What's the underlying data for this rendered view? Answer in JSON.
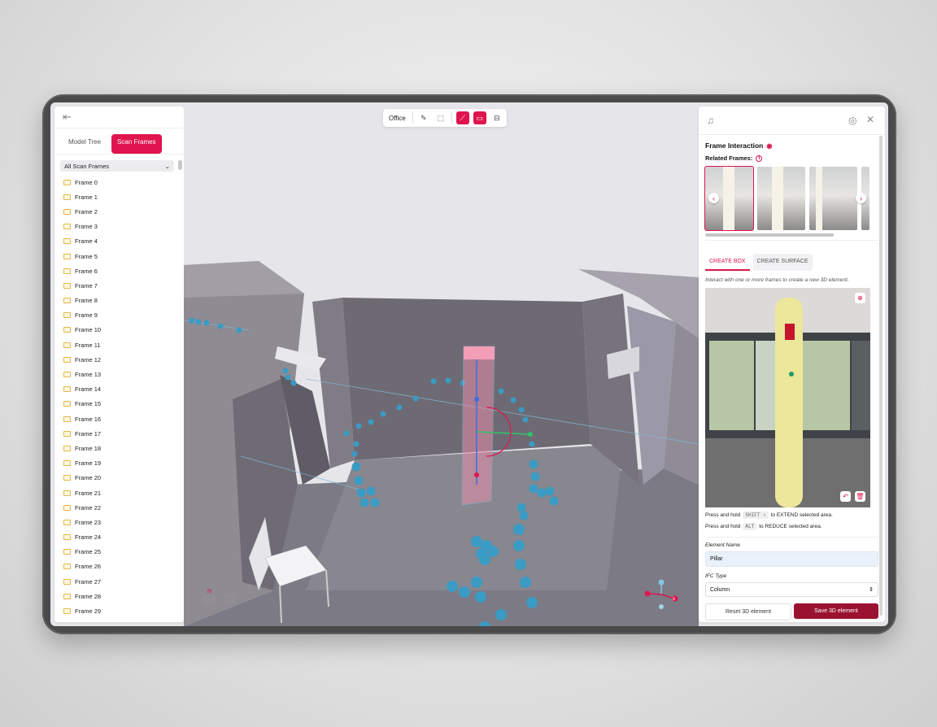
{
  "left_panel": {
    "tabs": [
      {
        "label": "Model Tree"
      },
      {
        "label": "Scan Frames"
      }
    ],
    "dropdown": "All Scan Frames",
    "frames": [
      "Frame 0",
      "Frame 1",
      "Frame 2",
      "Frame 3",
      "Frame 4",
      "Frame 5",
      "Frame 6",
      "Frame 7",
      "Frame 8",
      "Frame 9",
      "Frame 10",
      "Frame 11",
      "Frame 12",
      "Frame 13",
      "Frame 14",
      "Frame 15",
      "Frame 16",
      "Frame 17",
      "Frame 18",
      "Frame 19",
      "Frame 20",
      "Frame 21",
      "Frame 22",
      "Frame 23",
      "Frame 24",
      "Frame 25",
      "Frame 26",
      "Frame 27",
      "Frame 28",
      "Frame 29"
    ]
  },
  "toolbar": {
    "project": "Office",
    "icons": [
      "ruler-icon",
      "selection-icon",
      "path-icon",
      "box-icon",
      "paint-roller-icon"
    ]
  },
  "compass": {
    "n": "N",
    "x": "x"
  },
  "right_panel": {
    "title": "Frame Interaction",
    "related_frames": "Related Frames:",
    "tabs": [
      {
        "label": "CREATE BOX"
      },
      {
        "label": "CREATE SURFACE"
      }
    ],
    "hint": "Interact with one or more frames to create a new 3D element.",
    "press1_a": "Press and hold",
    "press1_key": "SHIFT ⇧",
    "press1_b": "to EXTEND selected area.",
    "press2_a": "Press and hold",
    "press2_key": "ALT",
    "press2_b": "to REDUCE selected area.",
    "element_name_label": "Element Name",
    "element_name_value": "Pillar",
    "ifc_type_label": "IFC Type",
    "ifc_type_value": "Column",
    "reset_label": "Reset 3D element",
    "save_label": "Save 3D element"
  },
  "colors": {
    "accent": "#e0144f",
    "save": "#9a1230",
    "sphere": "#3a9bc4"
  }
}
